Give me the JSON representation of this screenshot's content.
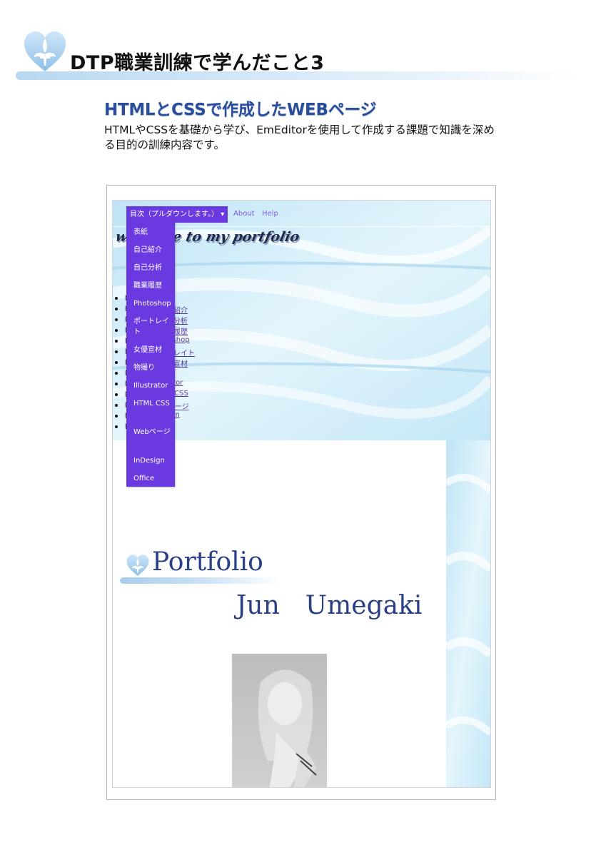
{
  "header": {
    "title": "DTP職業訓練で学んだこと3",
    "logo_icon": "fleur-de-lis-heart-icon"
  },
  "section": {
    "heading": "HTMLとCSSで作成したWEBページ",
    "description": "HTMLやCSSを基礎から学び、EmEditorを使用して作成する課題で知識を深める目的の訓練内容です。"
  },
  "screenshot": {
    "nav": {
      "dropdown_label": "目次（プルダウンします。）",
      "dropdown_caret": "▾",
      "about": "About",
      "help": "Help"
    },
    "banner_text": "welcome to my portfolio",
    "menu_items": [
      "表紙",
      "自己紹介",
      "自己分析",
      "職業履歴",
      "Photoshop",
      "ポートレイト",
      "女優宣材",
      "物撮り",
      "Illustrator",
      "HTML CSS",
      "Webページ",
      "InDesign",
      "Office"
    ],
    "bullet_prefix": "p",
    "bullet_links": [
      "",
      "自己紹介",
      "自己分析",
      "職業履歴",
      "Photoshop",
      "ポートレイト",
      "女優宣材",
      "",
      "Illustrator",
      "HTML CSS",
      "Webページ",
      "InDesign",
      ""
    ],
    "cover": {
      "title": "Portfolio",
      "name": "Jun　Umegaki"
    },
    "colors": {
      "menu_background": "#6a3ae0",
      "heading_blue": "#2a4d9c",
      "cover_text": "#2a3f86"
    }
  }
}
